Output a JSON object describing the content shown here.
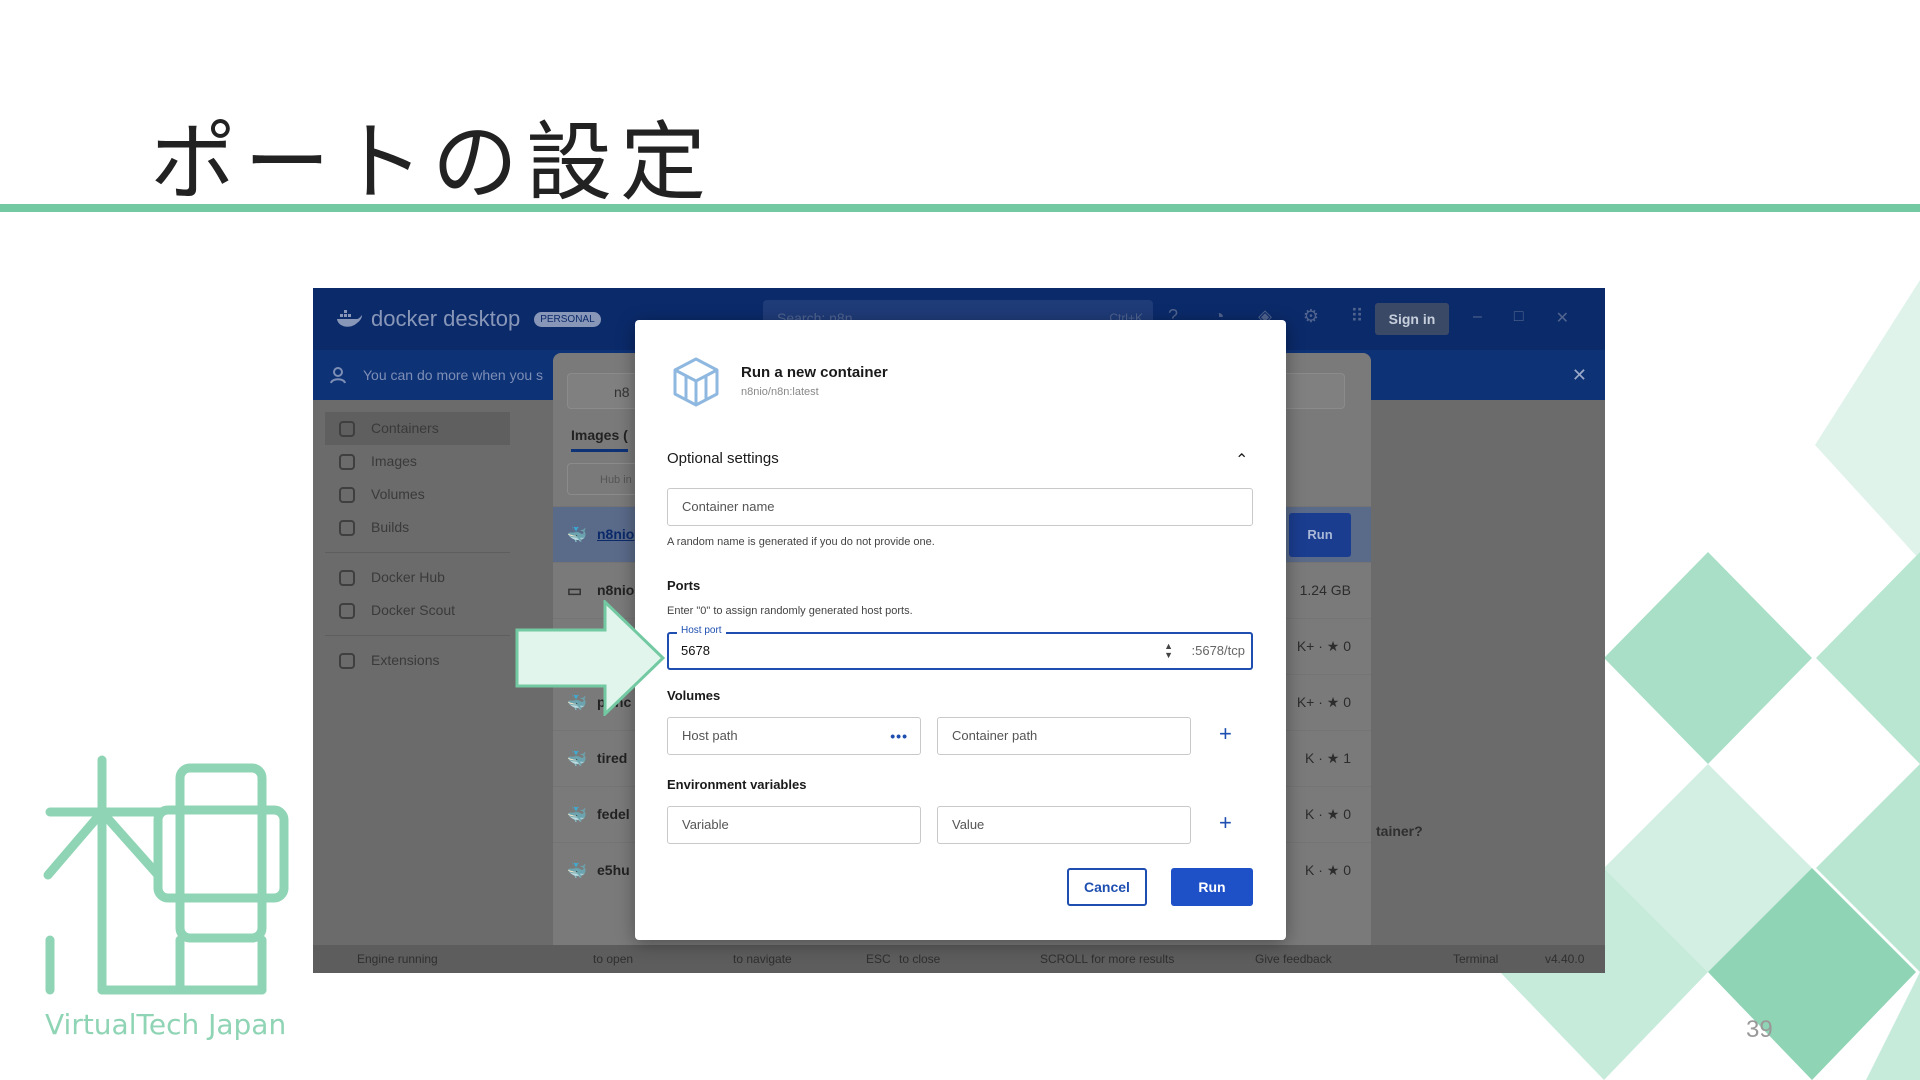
{
  "slide": {
    "title": "ポートの設定",
    "page_number": "39",
    "logo_text": "VirtualTech Japan"
  },
  "app": {
    "brand": "docker desktop",
    "badge": "PERSONAL",
    "search_placeholder": "Search: n8n",
    "search_shortcut": "Ctrl+K",
    "sign_in": "Sign in",
    "notice": "You can do more when you s"
  },
  "sidebar": {
    "items": [
      {
        "label": "Containers",
        "icon": "containers-icon"
      },
      {
        "label": "Images",
        "icon": "images-icon"
      },
      {
        "label": "Volumes",
        "icon": "volumes-icon"
      },
      {
        "label": "Builds",
        "icon": "builds-icon"
      },
      {
        "label": "Docker Hub",
        "icon": "docker-hub-icon"
      },
      {
        "label": "Docker Scout",
        "icon": "docker-scout-icon"
      },
      {
        "label": "Extensions",
        "icon": "extensions-icon"
      }
    ]
  },
  "panel": {
    "search_value": "n8",
    "tab": "Images (",
    "hub_filter": "Hub in",
    "rows": [
      {
        "name": "n8nio",
        "meta": "",
        "selected": true
      },
      {
        "name": "n8nio",
        "meta": "1.24 GB"
      },
      {
        "name": "",
        "meta": "K+ · ★ 0"
      },
      {
        "name": "princ",
        "meta": "K+ · ★ 0"
      },
      {
        "name": "tired",
        "meta": "K · ★ 1"
      },
      {
        "name": "fedel",
        "meta": "K · ★ 0"
      },
      {
        "name": "e5hu",
        "meta": "K · ★ 0"
      }
    ],
    "run_label": "Run",
    "side_question": "tainer?"
  },
  "modal": {
    "title": "Run a new container",
    "image": "n8nio/n8n:latest",
    "optional_settings": "Optional settings",
    "container_name_placeholder": "Container name",
    "container_name_helper": "A random name is generated if you do not provide one.",
    "ports_heading": "Ports",
    "ports_helper": "Enter \"0\" to assign randomly generated host ports.",
    "host_port_label": "Host port",
    "host_port_value": "5678",
    "container_port": ":5678/tcp",
    "volumes_heading": "Volumes",
    "host_path_placeholder": "Host path",
    "container_path_placeholder": "Container path",
    "env_heading": "Environment variables",
    "variable_placeholder": "Variable",
    "value_placeholder": "Value",
    "cancel": "Cancel",
    "run": "Run"
  },
  "footer": {
    "engine": "Engine running",
    "hint_open": "to open",
    "hint_navigate": "to navigate",
    "hint_esc_key": "ESC",
    "hint_close": "to close",
    "hint_scroll_key": "SCROLL",
    "hint_more": "for more results",
    "feedback": "Give feedback",
    "terminal": "Terminal",
    "version": "v4.40.0"
  },
  "colors": {
    "accent_green": "#72c9a2",
    "docker_navy": "#0b2a6a",
    "primary_blue": "#1e50c8"
  }
}
